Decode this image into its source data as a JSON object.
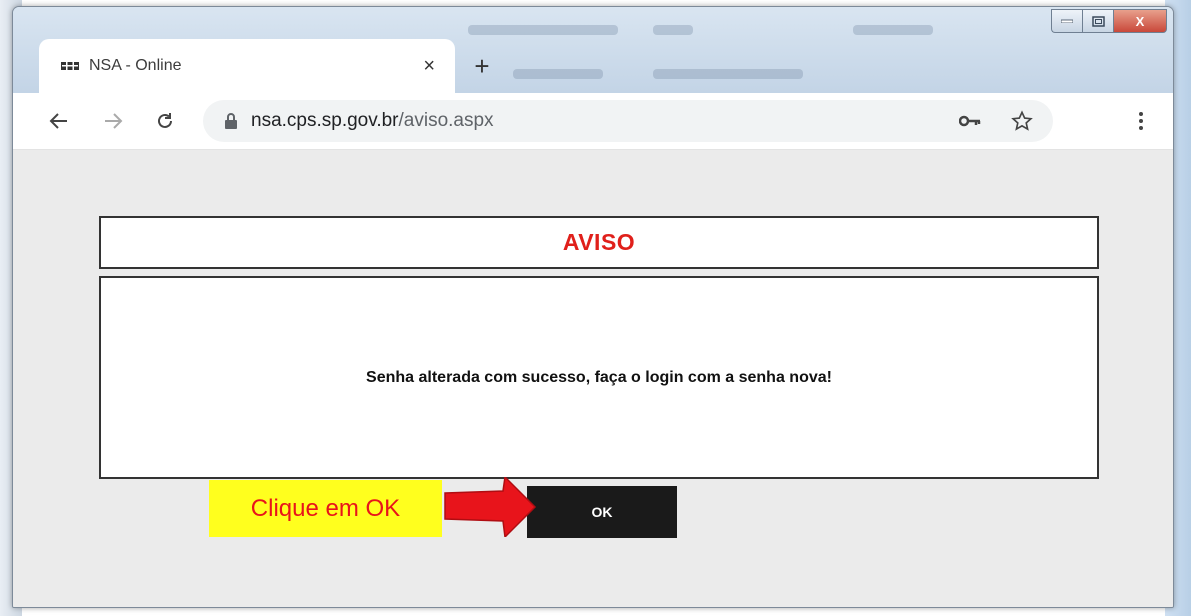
{
  "browser": {
    "tab_title": "NSA - Online",
    "tab_close": "×",
    "new_tab": "+",
    "url_host": "nsa.cps.sp.gov.br",
    "url_path": "/aviso.aspx",
    "window_close": "X"
  },
  "dialog": {
    "title": "AVISO",
    "message": "Senha alterada com sucesso, faça o login com a senha nova!",
    "ok_label": "OK"
  },
  "annotation": {
    "callout_text": "Clique em OK"
  },
  "colors": {
    "title_red": "#e0201b",
    "callout_yellow": "#ffff1e",
    "arrow_red": "#e8141b",
    "ok_button": "#1a1a1a"
  },
  "icons": [
    "back-arrow-icon",
    "forward-arrow-icon",
    "reload-icon",
    "lock-icon",
    "key-icon",
    "star-icon",
    "menu-dots-icon",
    "minimize-icon",
    "maximize-icon",
    "close-icon"
  ]
}
